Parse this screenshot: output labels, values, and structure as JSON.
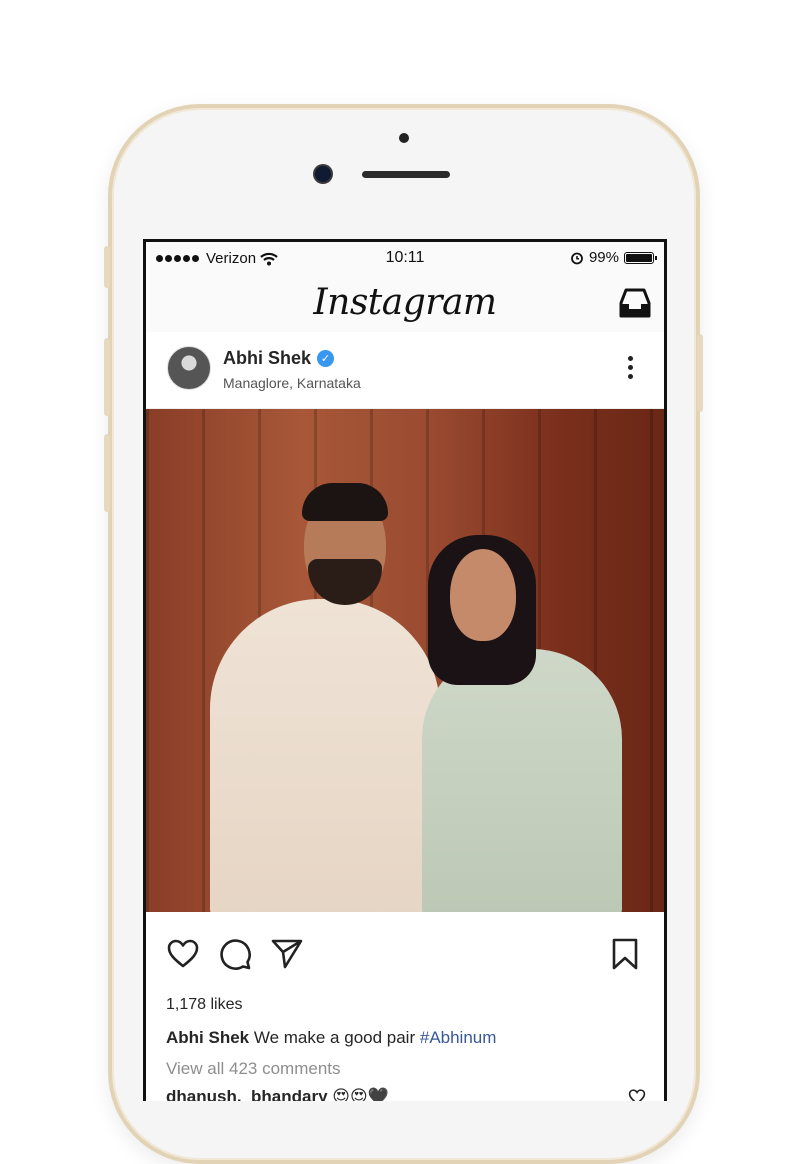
{
  "status": {
    "carrier": "Verizon",
    "time": "10:11",
    "battery": "99%",
    "battery_level": 0.99
  },
  "header": {
    "logo": "Instagram"
  },
  "post": {
    "username": "Abhi Shek",
    "location": "Managlore, Karnataka",
    "likes": "1,178 likes",
    "caption_user": "Abhi Shek",
    "caption_text": " We make a good pair ",
    "caption_tag": "#Abhinum",
    "view_all": "View all 423 comments",
    "comment": "dhanush._bhandary 😍😍🖤"
  },
  "colors": {
    "verified": "#3897f0",
    "hashtag": "#385898",
    "frame_gold": "#e2d3b6"
  }
}
